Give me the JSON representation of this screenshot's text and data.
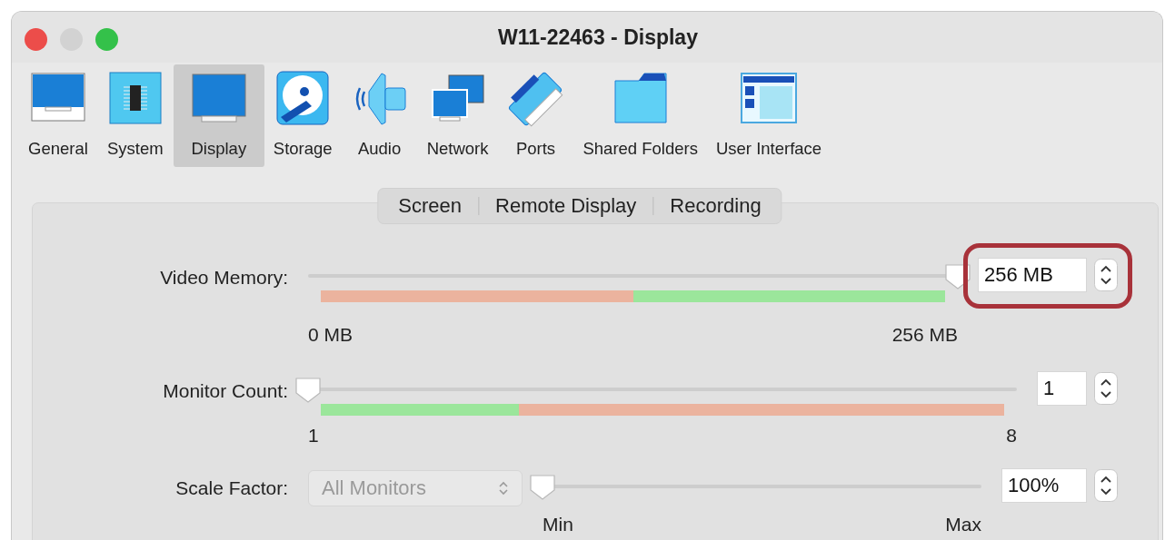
{
  "window": {
    "title": "W11-22463 - Display"
  },
  "toolbar": {
    "items": [
      {
        "label": "General",
        "kind": "general",
        "selected": false
      },
      {
        "label": "System",
        "kind": "system",
        "selected": false
      },
      {
        "label": "Display",
        "kind": "display",
        "selected": true
      },
      {
        "label": "Storage",
        "kind": "storage",
        "selected": false
      },
      {
        "label": "Audio",
        "kind": "audio",
        "selected": false
      },
      {
        "label": "Network",
        "kind": "network",
        "selected": false
      },
      {
        "label": "Ports",
        "kind": "ports",
        "selected": false
      },
      {
        "label": "Shared Folders",
        "kind": "folders",
        "selected": false
      },
      {
        "label": "User Interface",
        "kind": "ui",
        "selected": false
      }
    ]
  },
  "tabs": [
    {
      "label": "Screen"
    },
    {
      "label": "Remote Display"
    },
    {
      "label": "Recording"
    }
  ],
  "rows": [
    {
      "label": "Video Memory:",
      "level": 1,
      "value": "256 MB",
      "min_label": "0 MB",
      "max_label": "256 MB",
      "kind": "low-warning",
      "highlighted": true
    },
    {
      "label": "Monitor Count:",
      "level": 0,
      "value": "1",
      "min_label": "1",
      "max_label": "8",
      "kind": "high-warning",
      "highlighted": false
    },
    {
      "label": "Scale Factor:",
      "level": 0,
      "value": "100%",
      "min_label": "Min",
      "max_label": "Max",
      "kind": "plain",
      "highlighted": false,
      "dropdown": {
        "value": "All Monitors",
        "disabled": true
      }
    }
  ]
}
